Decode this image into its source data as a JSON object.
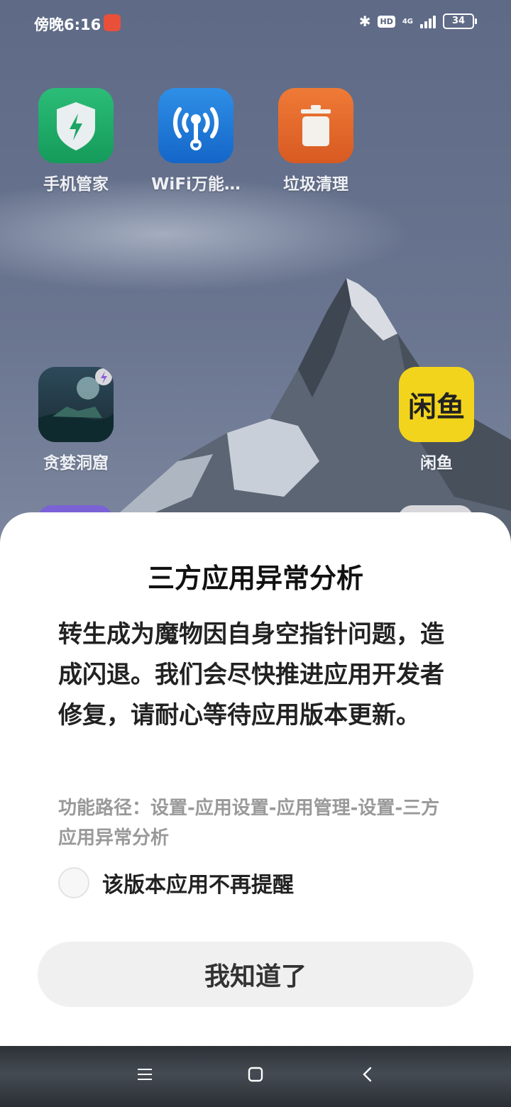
{
  "status": {
    "time": "傍晚6:16",
    "hd": "HD",
    "network": "4G",
    "battery": "34"
  },
  "apps": [
    {
      "name": "手机管家"
    },
    {
      "name": "WiFi万能…"
    },
    {
      "name": "垃圾清理"
    },
    {
      "name": "贪婪洞窟"
    },
    {
      "name": "闲鱼",
      "icon_text": "闲鱼"
    }
  ],
  "dialog": {
    "title": "三方应用异常分析",
    "message": "转生成为魔物因自身空指针问题，造成闪退。我们会尽快推进应用开发者修复，请耐心等待应用版本更新。",
    "path": "功能路径：设置-应用设置-应用管理-设置-三方应用异常分析",
    "checkbox_label": "该版本应用不再提醒",
    "checkbox_checked": false,
    "button": "我知道了"
  },
  "colors": {
    "xianyu": "#f2d41c",
    "security": "#22a868",
    "wifi": "#1f7fd8",
    "cleaner": "#e3692c"
  }
}
